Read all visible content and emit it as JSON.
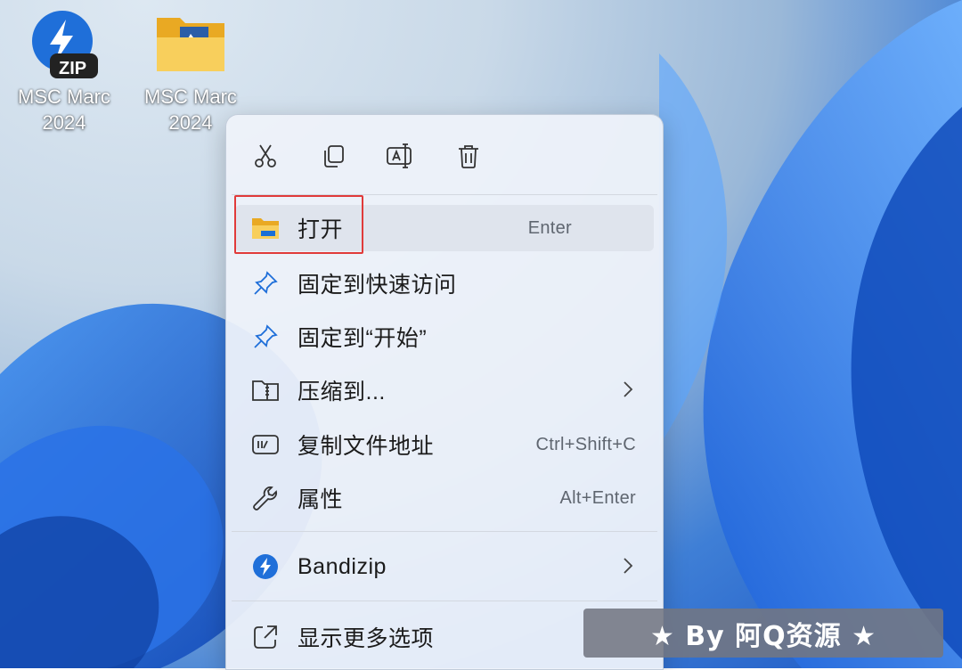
{
  "desktop": {
    "icons": [
      {
        "label_line1": "MSC Marc",
        "label_line2": "2024",
        "badge": "ZIP",
        "icon": "bandizip-archive-icon"
      },
      {
        "label_line1": "MSC Marc",
        "label_line2": "2024",
        "icon": "folder-icon"
      }
    ]
  },
  "context_menu": {
    "toolbar": [
      {
        "name": "cut",
        "icon": "scissors-icon"
      },
      {
        "name": "copy",
        "icon": "copy-icon"
      },
      {
        "name": "rename",
        "icon": "rename-icon"
      },
      {
        "name": "delete",
        "icon": "trash-icon"
      }
    ],
    "items": [
      {
        "label": "打开",
        "shortcut": "Enter",
        "icon": "folder-open-icon"
      },
      {
        "label": "固定到快速访问",
        "icon": "pin-icon"
      },
      {
        "label": "固定到“开始”",
        "icon": "pin-icon"
      },
      {
        "label": "压缩到...",
        "icon": "compress-icon",
        "submenu": true
      },
      {
        "label": "复制文件地址",
        "shortcut": "Ctrl+Shift+C",
        "icon": "copy-path-icon"
      },
      {
        "label": "属性",
        "shortcut": "Alt+Enter",
        "icon": "wrench-icon"
      },
      {
        "label": "Bandizip",
        "icon": "bandizip-icon",
        "submenu": true
      },
      {
        "label": "显示更多选项",
        "icon": "more-options-icon"
      }
    ],
    "highlight_color": "#e03a3a"
  },
  "watermark": {
    "text": "★ By 阿Q资源 ★"
  },
  "colors": {
    "accent": "#0067c0",
    "folder": "#f5c043",
    "bandizip": "#1f6fd9"
  }
}
